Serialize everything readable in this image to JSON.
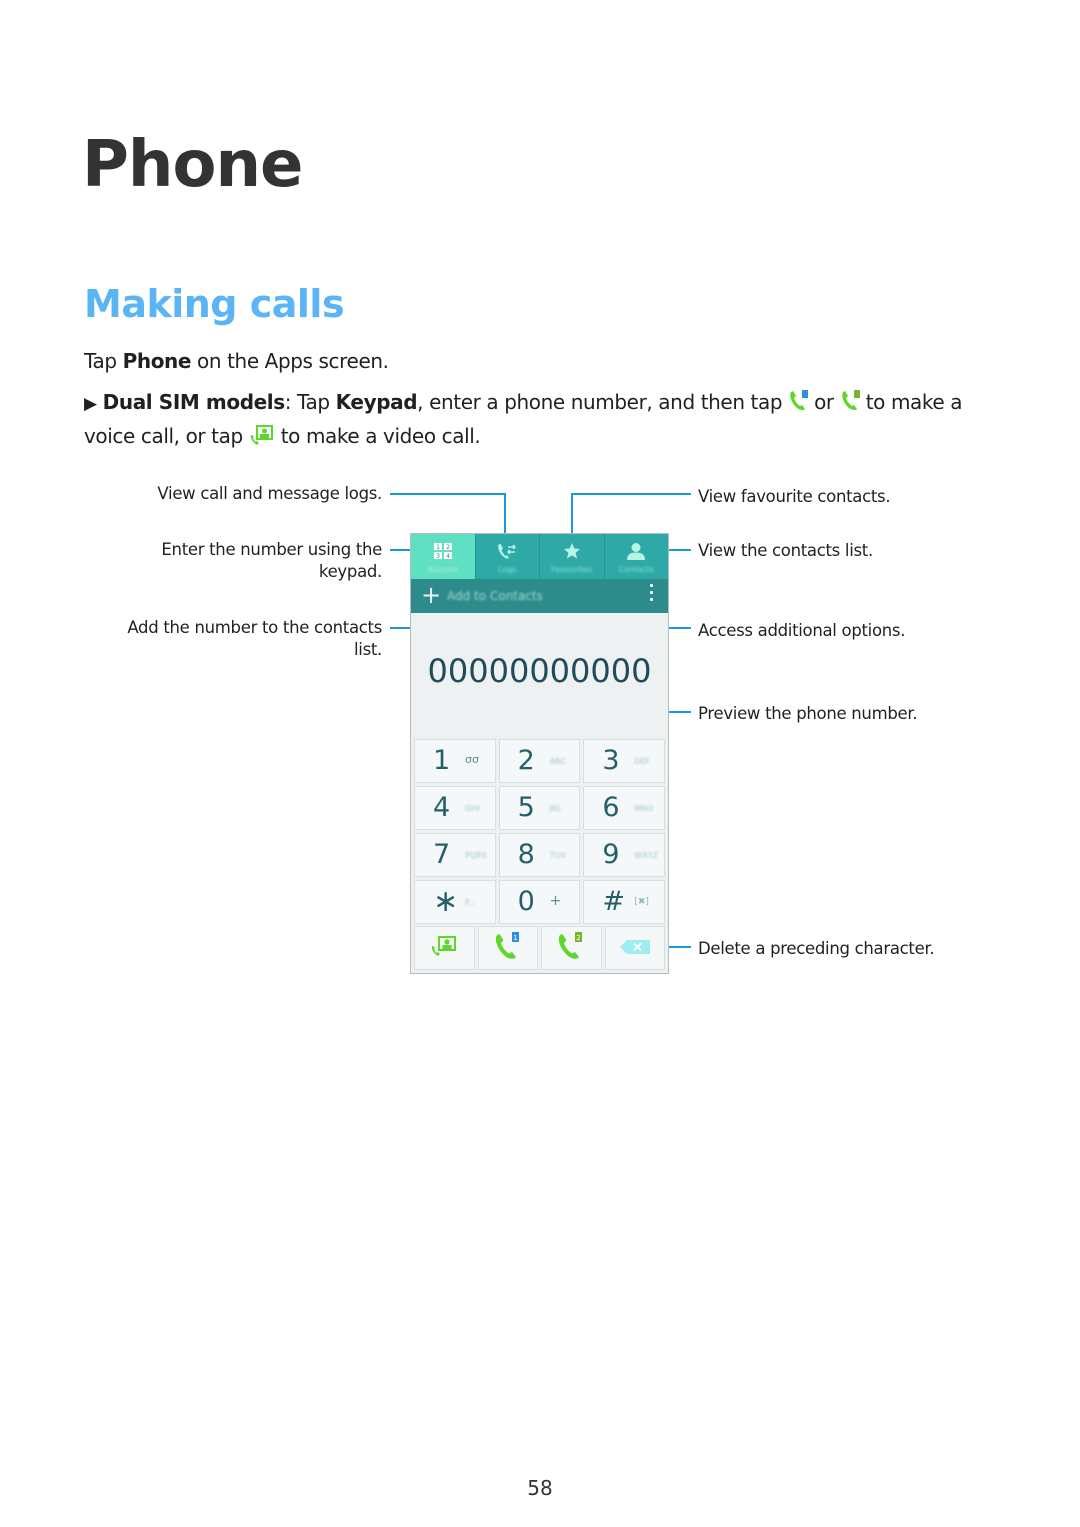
{
  "page": {
    "title": "Phone",
    "section_title": "Making calls",
    "page_number": "58"
  },
  "instructions": {
    "line1_prefix": "Tap ",
    "line1_bold": "Phone",
    "line1_suffix": " on the Apps screen.",
    "bullet_glyph": "▶",
    "dual_sim_bold": "Dual SIM models",
    "dual_sim_colon": ": Tap ",
    "keypad_bold": "Keypad",
    "dual_sim_text": ", enter a phone number, and then tap",
    "or_text": "or",
    "to_make_a": "to make a",
    "line3_prefix": "voice call, or tap",
    "line3_suffix": "to make a video call.",
    "icons": [
      "sim1-call-icon",
      "sim2-call-icon",
      "video-call-icon"
    ]
  },
  "callouts": {
    "logs": "View call and message logs.",
    "keypad_line1": "Enter the number using the",
    "keypad_line2": "keypad.",
    "add_contacts_line1": "Add the number to the contacts",
    "add_contacts_line2": "list.",
    "favourites": "View favourite contacts.",
    "contacts": "View the contacts list.",
    "options": "Access additional options.",
    "preview": "Preview the phone number.",
    "delete": "Delete a preceding character."
  },
  "phone": {
    "tabs": [
      {
        "label": "Keypad",
        "icon": "keypad-icon",
        "active": true
      },
      {
        "label": "Logs",
        "icon": "logs-icon",
        "active": false
      },
      {
        "label": "Favourites",
        "icon": "star-icon",
        "active": false
      },
      {
        "label": "Contacts",
        "icon": "contact-icon",
        "active": false
      }
    ],
    "add_to_contacts_label": "Add to Contacts",
    "add_icon": "+",
    "number_display": "00000000000",
    "keys": [
      {
        "digit": "1",
        "letters": "σσ"
      },
      {
        "digit": "2",
        "letters": "ABC"
      },
      {
        "digit": "3",
        "letters": "DEF"
      },
      {
        "digit": "4",
        "letters": "GHI"
      },
      {
        "digit": "5",
        "letters": "JKL"
      },
      {
        "digit": "6",
        "letters": "MNO"
      },
      {
        "digit": "7",
        "letters": "PQRS"
      },
      {
        "digit": "8",
        "letters": "TUV"
      },
      {
        "digit": "9",
        "letters": "WXYZ"
      },
      {
        "digit": "∗",
        "letters": "P,;"
      },
      {
        "digit": "0",
        "letters": "+"
      },
      {
        "digit": "#",
        "letters": "[✖]"
      }
    ],
    "call_buttons": [
      {
        "name": "video-call",
        "badge": ""
      },
      {
        "name": "sim1-call",
        "badge": "1"
      },
      {
        "name": "sim2-call",
        "badge": "2"
      },
      {
        "name": "delete",
        "badge": ""
      }
    ]
  },
  "colors": {
    "section_title": "#5ab4f5",
    "callout_line": "#1a9ad6",
    "tab_bar": "#2fa8a8",
    "tab_active": "#5fe0c2",
    "call_green": "#5fd62a",
    "sim1_badge": "#2f8fe0",
    "sim2_badge": "#7ab32c"
  }
}
